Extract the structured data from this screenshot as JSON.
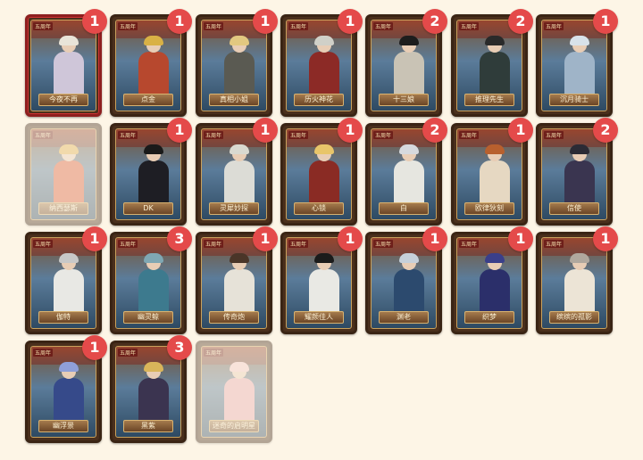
{
  "year_tag": "五周年",
  "cards": [
    {
      "name": "今夜不再",
      "count": "1",
      "selected": true,
      "dim": false,
      "body": "#cfc6d9",
      "hair": "#e9e4d8"
    },
    {
      "name": "点金",
      "count": "1",
      "selected": false,
      "dim": false,
      "body": "#b7482e",
      "hair": "#d9b145"
    },
    {
      "name": "真相小姐",
      "count": "1",
      "selected": false,
      "dim": false,
      "body": "#5a5a52",
      "hair": "#e2c880"
    },
    {
      "name": "历火神花",
      "count": "1",
      "selected": false,
      "dim": false,
      "body": "#8c2a26",
      "hair": "#d0d0c8"
    },
    {
      "name": "十三娘",
      "count": "2",
      "selected": false,
      "dim": false,
      "body": "#c9c3b5",
      "hair": "#1d1d1d"
    },
    {
      "name": "推理先生",
      "count": "2",
      "selected": false,
      "dim": false,
      "body": "#2f3c3a",
      "hair": "#2a2a2a"
    },
    {
      "name": "沉月骑士",
      "count": "1",
      "selected": false,
      "dim": false,
      "body": "#9fb4c8",
      "hair": "#d8e2ea"
    },
    {
      "name": "纳西瑟斯",
      "count": "",
      "selected": false,
      "dim": true,
      "body": "#d95b3b",
      "hair": "#e0b050"
    },
    {
      "name": "DK",
      "count": "1",
      "selected": false,
      "dim": false,
      "body": "#1e1e24",
      "hair": "#1a1a1a"
    },
    {
      "name": "灵犀妙探",
      "count": "1",
      "selected": false,
      "dim": false,
      "body": "#dcdcd6",
      "hair": "#d9d9d0"
    },
    {
      "name": "心锁",
      "count": "1",
      "selected": false,
      "dim": false,
      "body": "#8a2b24",
      "hair": "#e8c56a"
    },
    {
      "name": "白",
      "count": "2",
      "selected": false,
      "dim": false,
      "body": "#e6e6e0",
      "hair": "#d6d9dd"
    },
    {
      "name": "欧律狄刻",
      "count": "1",
      "selected": false,
      "dim": false,
      "body": "#e6d8c2",
      "hair": "#b8602e"
    },
    {
      "name": "信使",
      "count": "2",
      "selected": false,
      "dim": false,
      "body": "#3a3550",
      "hair": "#2b2b35"
    },
    {
      "name": "伽特",
      "count": "1",
      "selected": false,
      "dim": false,
      "body": "#e8e8e4",
      "hair": "#c8c8c8"
    },
    {
      "name": "幽灵鲸",
      "count": "3",
      "selected": false,
      "dim": false,
      "body": "#3d7a8e",
      "hair": "#7fa7b3"
    },
    {
      "name": "传奇炮",
      "count": "1",
      "selected": false,
      "dim": false,
      "body": "#e6e2d8",
      "hair": "#4a3528"
    },
    {
      "name": "耀颜佳人",
      "count": "1",
      "selected": false,
      "dim": false,
      "body": "#e9e9e4",
      "hair": "#1b1b1b"
    },
    {
      "name": "渊老",
      "count": "1",
      "selected": false,
      "dim": false,
      "body": "#2c4a6e",
      "hair": "#c6d0da"
    },
    {
      "name": "织梦",
      "count": "1",
      "selected": false,
      "dim": false,
      "body": "#2b2f6a",
      "hair": "#3a3f8a"
    },
    {
      "name": "缤缤的孤影",
      "count": "1",
      "selected": false,
      "dim": false,
      "body": "#ece4d6",
      "hair": "#b0a89e"
    },
    {
      "name": "幽浮景",
      "count": "1",
      "selected": false,
      "dim": false,
      "body": "#364a8a",
      "hair": "#8f9fd8"
    },
    {
      "name": "黑紫",
      "count": "3",
      "selected": false,
      "dim": false,
      "body": "#3b3450",
      "hair": "#d9b55a"
    },
    {
      "name": "迷奇的启明星",
      "count": "",
      "selected": false,
      "dim": true,
      "body": "#e7a7b0",
      "hair": "#f0c6c8"
    }
  ]
}
